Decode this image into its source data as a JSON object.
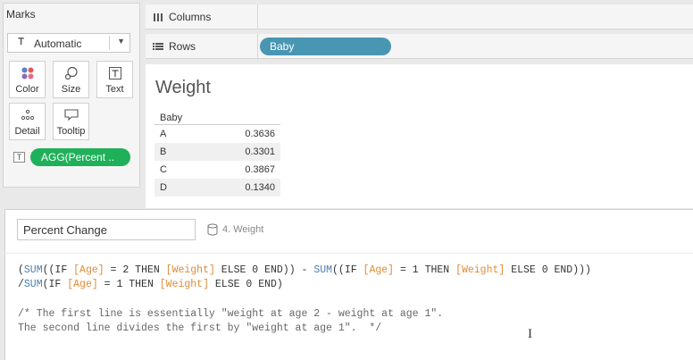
{
  "marks": {
    "title": "Marks",
    "mark_type": "Automatic",
    "buttons": [
      {
        "label": "Color",
        "icon": "color-dots-icon"
      },
      {
        "label": "Size",
        "icon": "size-shapes-icon"
      },
      {
        "label": "Text",
        "icon": "text-t-icon"
      },
      {
        "label": "Detail",
        "icon": "detail-dots-icon"
      },
      {
        "label": "Tooltip",
        "icon": "tooltip-bubble-icon"
      }
    ],
    "field_pill": "AGG(Percent ..",
    "pill_color": "#1fb05a"
  },
  "shelves": {
    "columns_label": "Columns",
    "rows_label": "Rows",
    "rows_pill": "Baby",
    "rows_pill_color": "#4996b2"
  },
  "view": {
    "title": "Weight",
    "table": {
      "header": "Baby",
      "rows": [
        {
          "key": "A",
          "value": "0.3636"
        },
        {
          "key": "B",
          "value": "0.3301"
        },
        {
          "key": "C",
          "value": "0.3867"
        },
        {
          "key": "D",
          "value": "0.1340"
        }
      ]
    }
  },
  "calc": {
    "name": "Percent Change",
    "datasource": "4. Weight",
    "code_lines": [
      "(SUM((IF [Age] = 2 THEN [Weight] ELSE 0 END)) - SUM((IF [Age] = 1 THEN [Weight] ELSE 0 END)))",
      "/SUM(IF [Age] = 1 THEN [Weight] ELSE 0 END)",
      "",
      "/* The first line is essentially \"weight at age 2 - weight at age 1\".",
      "The second line divides the first by \"weight at age 1\".  */"
    ],
    "colors": {
      "function": "#4a7fb0",
      "field": "#e08c37",
      "comment": "#666666"
    }
  }
}
